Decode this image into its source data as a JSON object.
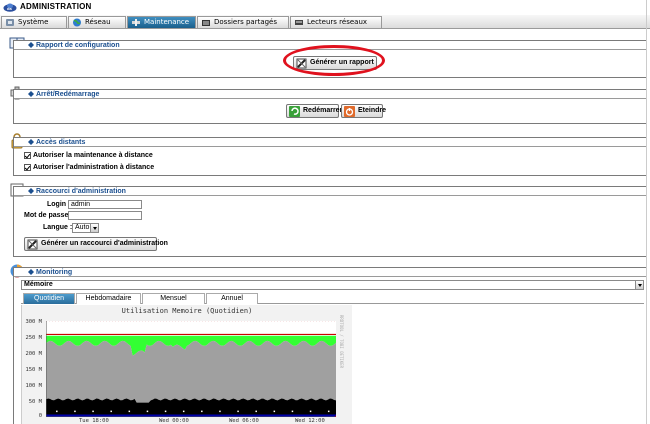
{
  "app": {
    "title": "ADMINISTRATION"
  },
  "tabs": [
    {
      "label": "Système",
      "icon": "wrench-icon",
      "active": false
    },
    {
      "label": "Réseau",
      "icon": "globe-icon",
      "active": false
    },
    {
      "label": "Maintenance",
      "icon": "tools-icon",
      "active": true
    },
    {
      "label": "Dossiers partagés",
      "icon": "folder-share-icon",
      "active": false
    },
    {
      "label": "Lecteurs réseaux",
      "icon": "network-drive-icon",
      "active": false
    }
  ],
  "sections": {
    "rapport": {
      "title": "Rapport de configuration",
      "button": "Générer un rapport"
    },
    "arret": {
      "title": "Arrêt/Redémarrage",
      "restart": "Redémarrer",
      "shutdown": "Eteindre"
    },
    "acces": {
      "title": "Accès distants",
      "options": [
        {
          "label": "Autoriser la maintenance à distance",
          "checked": true
        },
        {
          "label": "Autoriser l'administration à distance",
          "checked": true
        }
      ]
    },
    "raccourci": {
      "title": "Raccourci d'administration",
      "login_label": "Login :",
      "login_value": "admin",
      "password_label": "Mot de passe :",
      "password_value": "",
      "language_label": "Langue :",
      "language_value": "Auto",
      "button": "Générer un raccourci d'administration"
    },
    "monitoring": {
      "title": "Monitoring",
      "select_value": "Mémoire",
      "subtabs": [
        {
          "label": "Quotidien",
          "active": true
        },
        {
          "label": "Hebdomadaire",
          "active": false
        },
        {
          "label": "Mensuel",
          "active": false
        },
        {
          "label": "Annuel",
          "active": false
        }
      ]
    }
  },
  "chart_data": {
    "type": "area",
    "title": "Utilisation Memoire (Quotidien)",
    "y_ticks": [
      "300 M",
      "250 M",
      "200 M",
      "150 M",
      "100 M",
      "50 M",
      "0"
    ],
    "ylim": [
      0,
      300
    ],
    "x_ticks": [
      "Tue 18:00",
      "Wed 00:00",
      "Wed 06:00",
      "Wed 12:00"
    ],
    "side_label": "RRDTOOL / TOBI OETIKER",
    "colors": {
      "free": "#33ff33",
      "cache": "#a0a0a0",
      "buffers": "#000000",
      "used": "#0000aa",
      "limit_line": "#cc0000"
    },
    "limit_value": 258
  }
}
